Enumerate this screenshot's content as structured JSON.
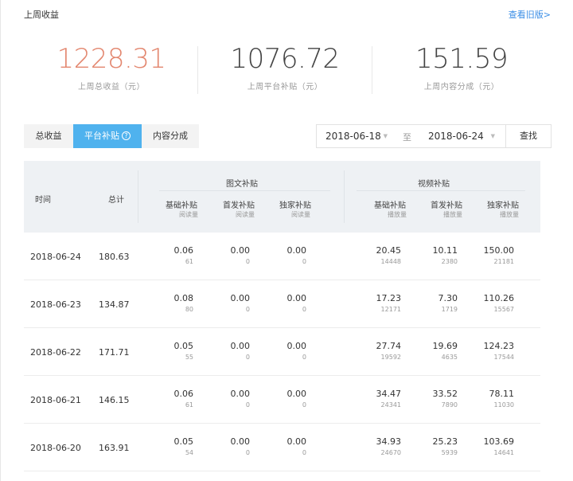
{
  "header": {
    "title": "上周收益",
    "old_version_link": "查看旧版>"
  },
  "summary": [
    {
      "value": "1228.31",
      "label": "上周总收益（元）",
      "color": "#e3876f"
    },
    {
      "value": "1076.72",
      "label": "上周平台补贴（元）",
      "color": "#444444"
    },
    {
      "value": "151.59",
      "label": "上周内容分成（元）",
      "color": "#444444"
    }
  ],
  "tabs": [
    {
      "label": "总收益"
    },
    {
      "label": "平台补贴"
    },
    {
      "label": "内容分成"
    }
  ],
  "date_range": {
    "start": "2018-06-18",
    "separator": "至",
    "end": "2018-06-24",
    "query_label": "查找"
  },
  "table": {
    "col_time": "时间",
    "col_total": "总计",
    "group_article": "图文补贴",
    "group_video": "视频补贴",
    "article_cols": [
      {
        "label": "基础补贴",
        "sub": "阅读量"
      },
      {
        "label": "首发补贴",
        "sub": "阅读量"
      },
      {
        "label": "独家补贴",
        "sub": "阅读量"
      }
    ],
    "video_cols": [
      {
        "label": "基础补贴",
        "sub": "播放量"
      },
      {
        "label": "首发补贴",
        "sub": "播放量"
      },
      {
        "label": "独家补贴",
        "sub": "播放量"
      }
    ],
    "rows": [
      {
        "date": "2018-06-24",
        "total": "180.63",
        "article": [
          [
            "0.06",
            "61"
          ],
          [
            "0.00",
            "0"
          ],
          [
            "0.00",
            "0"
          ]
        ],
        "video": [
          [
            "20.45",
            "14448"
          ],
          [
            "10.11",
            "2380"
          ],
          [
            "150.00",
            "21181"
          ]
        ]
      },
      {
        "date": "2018-06-23",
        "total": "134.87",
        "article": [
          [
            "0.08",
            "80"
          ],
          [
            "0.00",
            "0"
          ],
          [
            "0.00",
            "0"
          ]
        ],
        "video": [
          [
            "17.23",
            "12171"
          ],
          [
            "7.30",
            "1719"
          ],
          [
            "110.26",
            "15567"
          ]
        ]
      },
      {
        "date": "2018-06-22",
        "total": "171.71",
        "article": [
          [
            "0.05",
            "55"
          ],
          [
            "0.00",
            "0"
          ],
          [
            "0.00",
            "0"
          ]
        ],
        "video": [
          [
            "27.74",
            "19592"
          ],
          [
            "19.69",
            "4635"
          ],
          [
            "124.23",
            "17544"
          ]
        ]
      },
      {
        "date": "2018-06-21",
        "total": "146.15",
        "article": [
          [
            "0.06",
            "61"
          ],
          [
            "0.00",
            "0"
          ],
          [
            "0.00",
            "0"
          ]
        ],
        "video": [
          [
            "34.47",
            "24341"
          ],
          [
            "33.52",
            "7890"
          ],
          [
            "78.11",
            "11030"
          ]
        ]
      },
      {
        "date": "2018-06-20",
        "total": "163.91",
        "article": [
          [
            "0.05",
            "54"
          ],
          [
            "0.00",
            "0"
          ],
          [
            "0.00",
            "0"
          ]
        ],
        "video": [
          [
            "34.93",
            "24670"
          ],
          [
            "25.23",
            "5939"
          ],
          [
            "103.69",
            "14641"
          ]
        ]
      }
    ]
  }
}
